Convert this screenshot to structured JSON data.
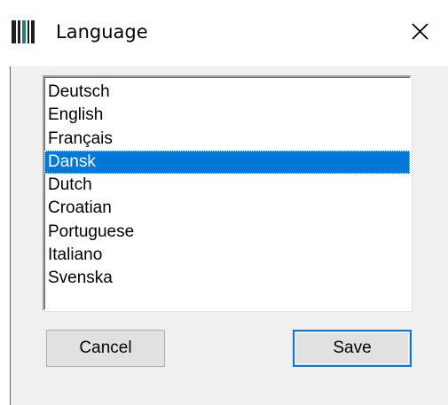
{
  "window": {
    "title": "Language",
    "app_icon": "barcode-app-icon",
    "close_icon": "close-icon",
    "accent_color": "#0078d7"
  },
  "listbox": {
    "items": [
      {
        "label": "Deutsch",
        "selected": false
      },
      {
        "label": "English",
        "selected": false
      },
      {
        "label": "Français",
        "selected": false
      },
      {
        "label": "Dansk",
        "selected": true
      },
      {
        "label": "Dutch",
        "selected": false
      },
      {
        "label": "Croatian",
        "selected": false
      },
      {
        "label": "Portuguese",
        "selected": false
      },
      {
        "label": "Italiano",
        "selected": false
      },
      {
        "label": "Svenska",
        "selected": false
      }
    ]
  },
  "buttons": {
    "cancel_label": "Cancel",
    "save_label": "Save"
  }
}
